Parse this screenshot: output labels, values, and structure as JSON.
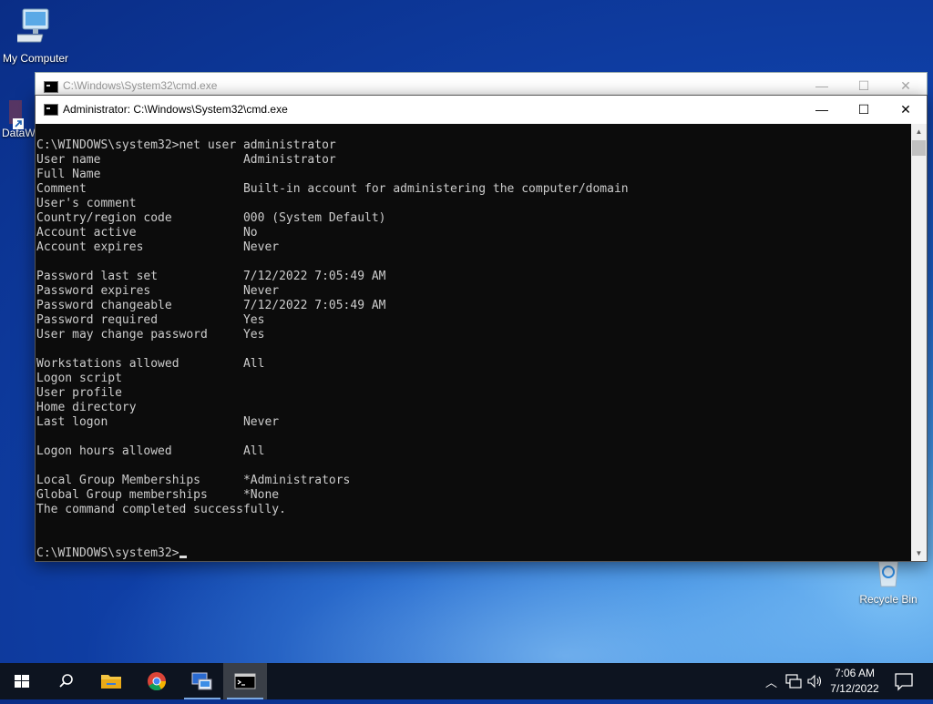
{
  "desktop": {
    "icons": [
      {
        "label": "My Computer"
      },
      {
        "label": "DataW"
      },
      {
        "label": "Recycle Bin"
      }
    ]
  },
  "back_window": {
    "title": "C:\\Windows\\System32\\cmd.exe"
  },
  "front_window": {
    "title": "Administrator: C:\\Windows\\System32\\cmd.exe",
    "controls": {
      "minimize": "—",
      "maximize": "☐",
      "close": "✕"
    }
  },
  "console": {
    "lines": [
      "C:\\WINDOWS\\system32>net user administrator",
      "User name                    Administrator",
      "Full Name",
      "Comment                      Built-in account for administering the computer/domain",
      "User's comment",
      "Country/region code          000 (System Default)",
      "Account active               No",
      "Account expires              Never",
      "",
      "Password last set            7/12/2022 7:05:49 AM",
      "Password expires             Never",
      "Password changeable          7/12/2022 7:05:49 AM",
      "Password required            Yes",
      "User may change password     Yes",
      "",
      "Workstations allowed         All",
      "Logon script",
      "User profile",
      "Home directory",
      "Last logon                   Never",
      "",
      "Logon hours allowed          All",
      "",
      "Local Group Memberships      *Administrators",
      "Global Group memberships     *None",
      "The command completed successfully.",
      "",
      ""
    ],
    "prompt": "C:\\WINDOWS\\system32>"
  },
  "taskbar": {
    "clock_time": "7:06 AM",
    "clock_date": "7/12/2022"
  }
}
